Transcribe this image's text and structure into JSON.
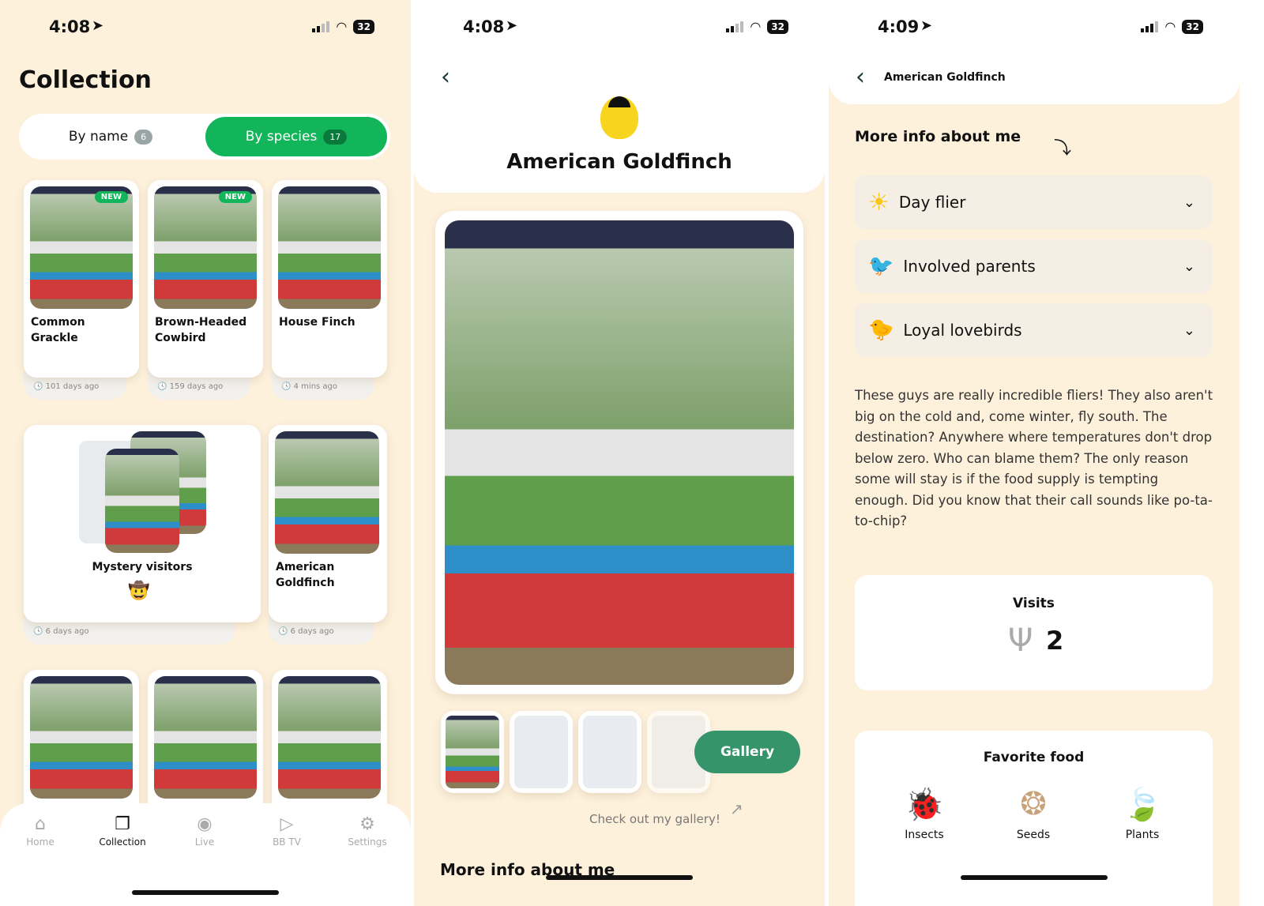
{
  "status_bars": [
    {
      "time": "4:08",
      "battery": "32"
    },
    {
      "time": "4:08",
      "battery": "32"
    },
    {
      "time": "4:09",
      "battery": "32"
    }
  ],
  "collection": {
    "title": "Collection",
    "tabs": [
      {
        "label": "By name",
        "count": "6",
        "active": false
      },
      {
        "label": "By species",
        "count": "17",
        "active": true
      }
    ],
    "cards": [
      {
        "name": "Common Grackle",
        "time": "101 days ago",
        "badge": "NEW"
      },
      {
        "name": "Brown-Headed Cowbird",
        "time": "159 days ago",
        "badge": "NEW"
      },
      {
        "name": "House Finch",
        "time": "4 mins ago"
      },
      {
        "name": "Mystery visitors",
        "time": "6 days ago"
      },
      {
        "name": "American Goldfinch",
        "time": "6 days ago"
      }
    ],
    "nav": [
      {
        "label": "Home",
        "icon": "home-icon"
      },
      {
        "label": "Collection",
        "icon": "collection-icon",
        "active": true
      },
      {
        "label": "Live",
        "icon": "live-icon"
      },
      {
        "label": "BB TV",
        "icon": "tv-icon"
      },
      {
        "label": "Settings",
        "icon": "gear-icon"
      }
    ]
  },
  "detail": {
    "title": "American Goldfinch",
    "gallery_button": "Gallery",
    "gallery_hint": "Check out my gallery!",
    "more_info": "More info about me"
  },
  "info": {
    "header_title": "American Goldfinch",
    "section_title": "More info about me",
    "traits": [
      {
        "label": "Day flier",
        "icon": "sun-icon"
      },
      {
        "label": "Involved parents",
        "icon": "parents-icon"
      },
      {
        "label": "Loyal lovebirds",
        "icon": "lovebirds-icon"
      }
    ],
    "description": "These guys are really incredible fliers! They also aren't big on the cold and, come winter, fly south. The destination? Anywhere where temperatures don't drop below zero. Who can blame them? The only reason some will stay is if the food supply is tempting enough. Did you know that their call sounds like po-ta-to-chip?",
    "visits_label": "Visits",
    "visits_count": "2",
    "food_title": "Favorite food",
    "foods": [
      {
        "label": "Insects",
        "icon": "insect-icon"
      },
      {
        "label": "Seeds",
        "icon": "seeds-icon"
      },
      {
        "label": "Plants",
        "icon": "leaf-icon"
      }
    ]
  },
  "colors": {
    "background": "#fdf1dc",
    "accent_green": "#12b559",
    "gallery_green": "#36946a"
  }
}
